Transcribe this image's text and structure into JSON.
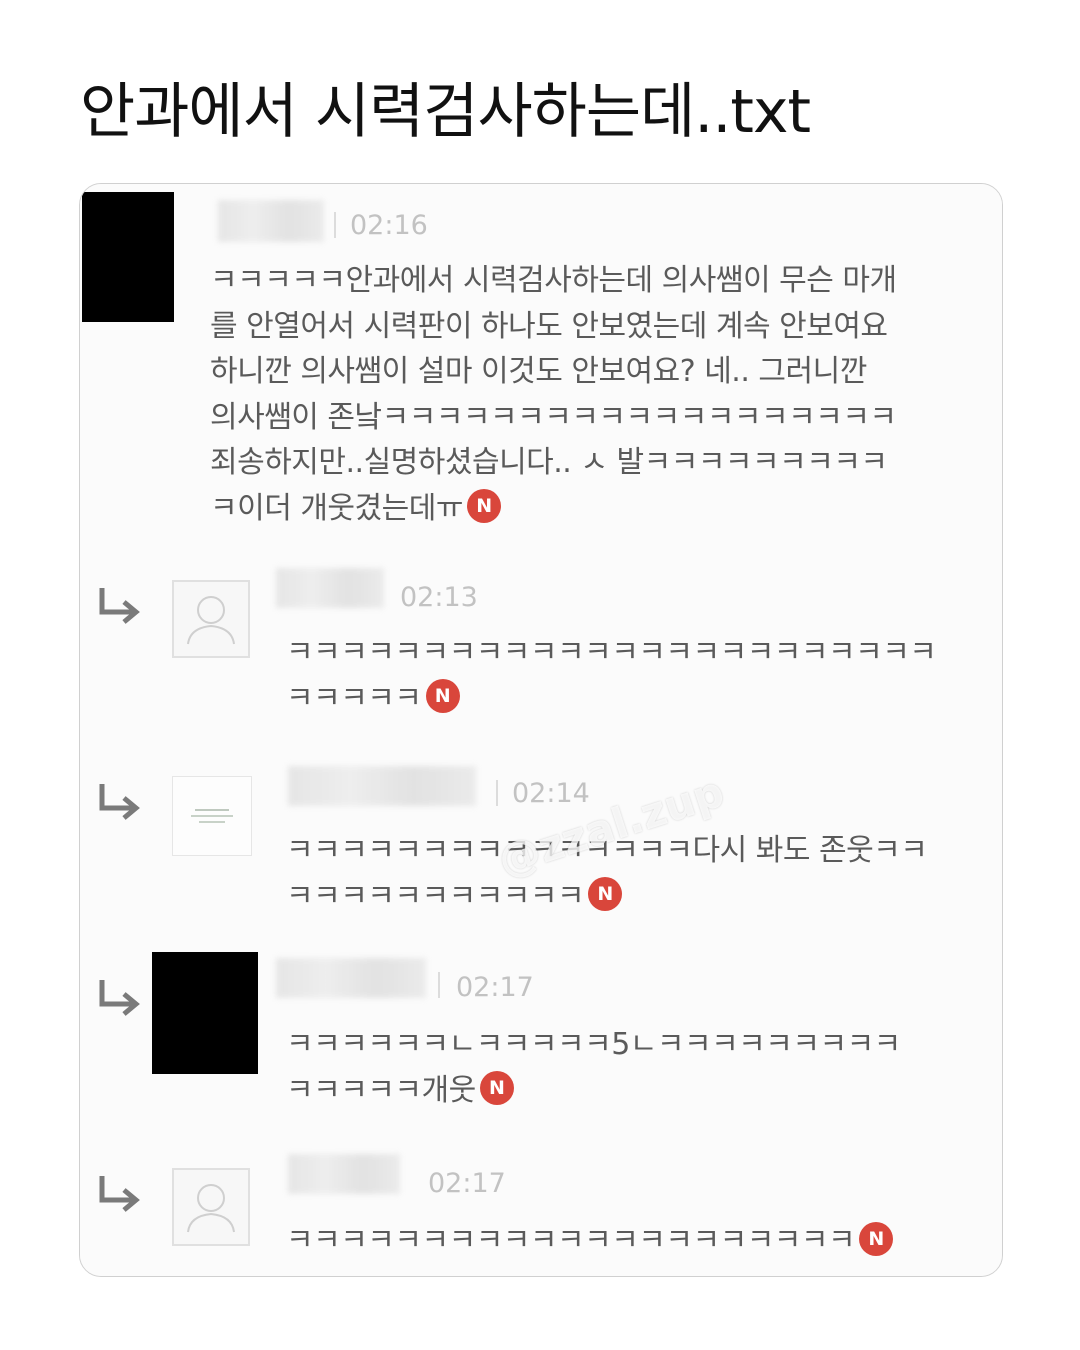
{
  "post": {
    "title": "안과에서 시력검사하는데..txt"
  },
  "colors": {
    "badge": "#d9463b",
    "timestamp": "#c2c2c2",
    "text": "#5a5a5a"
  },
  "comments": [
    {
      "time": "02:16",
      "lines": [
        "ㅋㅋㅋㅋㅋ안과에서 시력검사하는데 의사쌤이 무슨 마개",
        "를 안열어서 시력판이 하나도 안보였는데 계속 안보여요",
        "하니깐 의사쌤이 설마 이것도 안보여요? 네.. 그러니깐",
        "의사쌤이 존낰ㅋㅋㅋㅋㅋㅋㅋㅋㅋㅋㅋㅋㅋㅋㅋㅋㅋㅋㅋ",
        "죄송하지만..실명하셨습니다.. ㅅ 발ㅋㅋㅋㅋㅋㅋㅋㅋㅋ",
        "ㅋ이더 개웃겼는데ㅠ"
      ],
      "badge": "N"
    },
    {
      "time": "02:13",
      "lines": [
        "ㅋㅋㅋㅋㅋㅋㅋㅋㅋㅋㅋㅋㅋㅋㅋㅋㅋㅋㅋㅋㅋㅋㅋㅋ",
        "ㅋㅋㅋㅋㅋ"
      ],
      "badge": "N"
    },
    {
      "time": "02:14",
      "lines": [
        "ㅋㅋㅋㅋㅋㅋㅋㅋㅋㅋㅋㅋㅋㅋㅋ다시 봐도 존웃ㅋㅋ",
        "ㅋㅋㅋㅋㅋㅋㅋㅋㅋㅋㅋ"
      ],
      "badge": "N"
    },
    {
      "time": "02:17",
      "lines": [
        "ㅋㅋㅋㅋㅋㅋㄴㅋㅋㅋㅋㅋ5ㄴㅋㅋㅋㅋㅋㅋㅋㅋㅋ",
        "ㅋㅋㅋㅋㅋ개웃"
      ],
      "badge": "N"
    },
    {
      "time": "02:17",
      "lines": [
        "ㅋㅋㅋㅋㅋㅋㅋㅋㅋㅋㅋㅋㅋㅋㅋㅋㅋㅋㅋㅋㅋ"
      ],
      "badge": "N"
    }
  ],
  "watermark": "@zzal.zup",
  "icons": {
    "reply": "reply-arrow-icon",
    "default_avatar": "default-avatar-icon",
    "new_badge": "new-badge-icon"
  }
}
